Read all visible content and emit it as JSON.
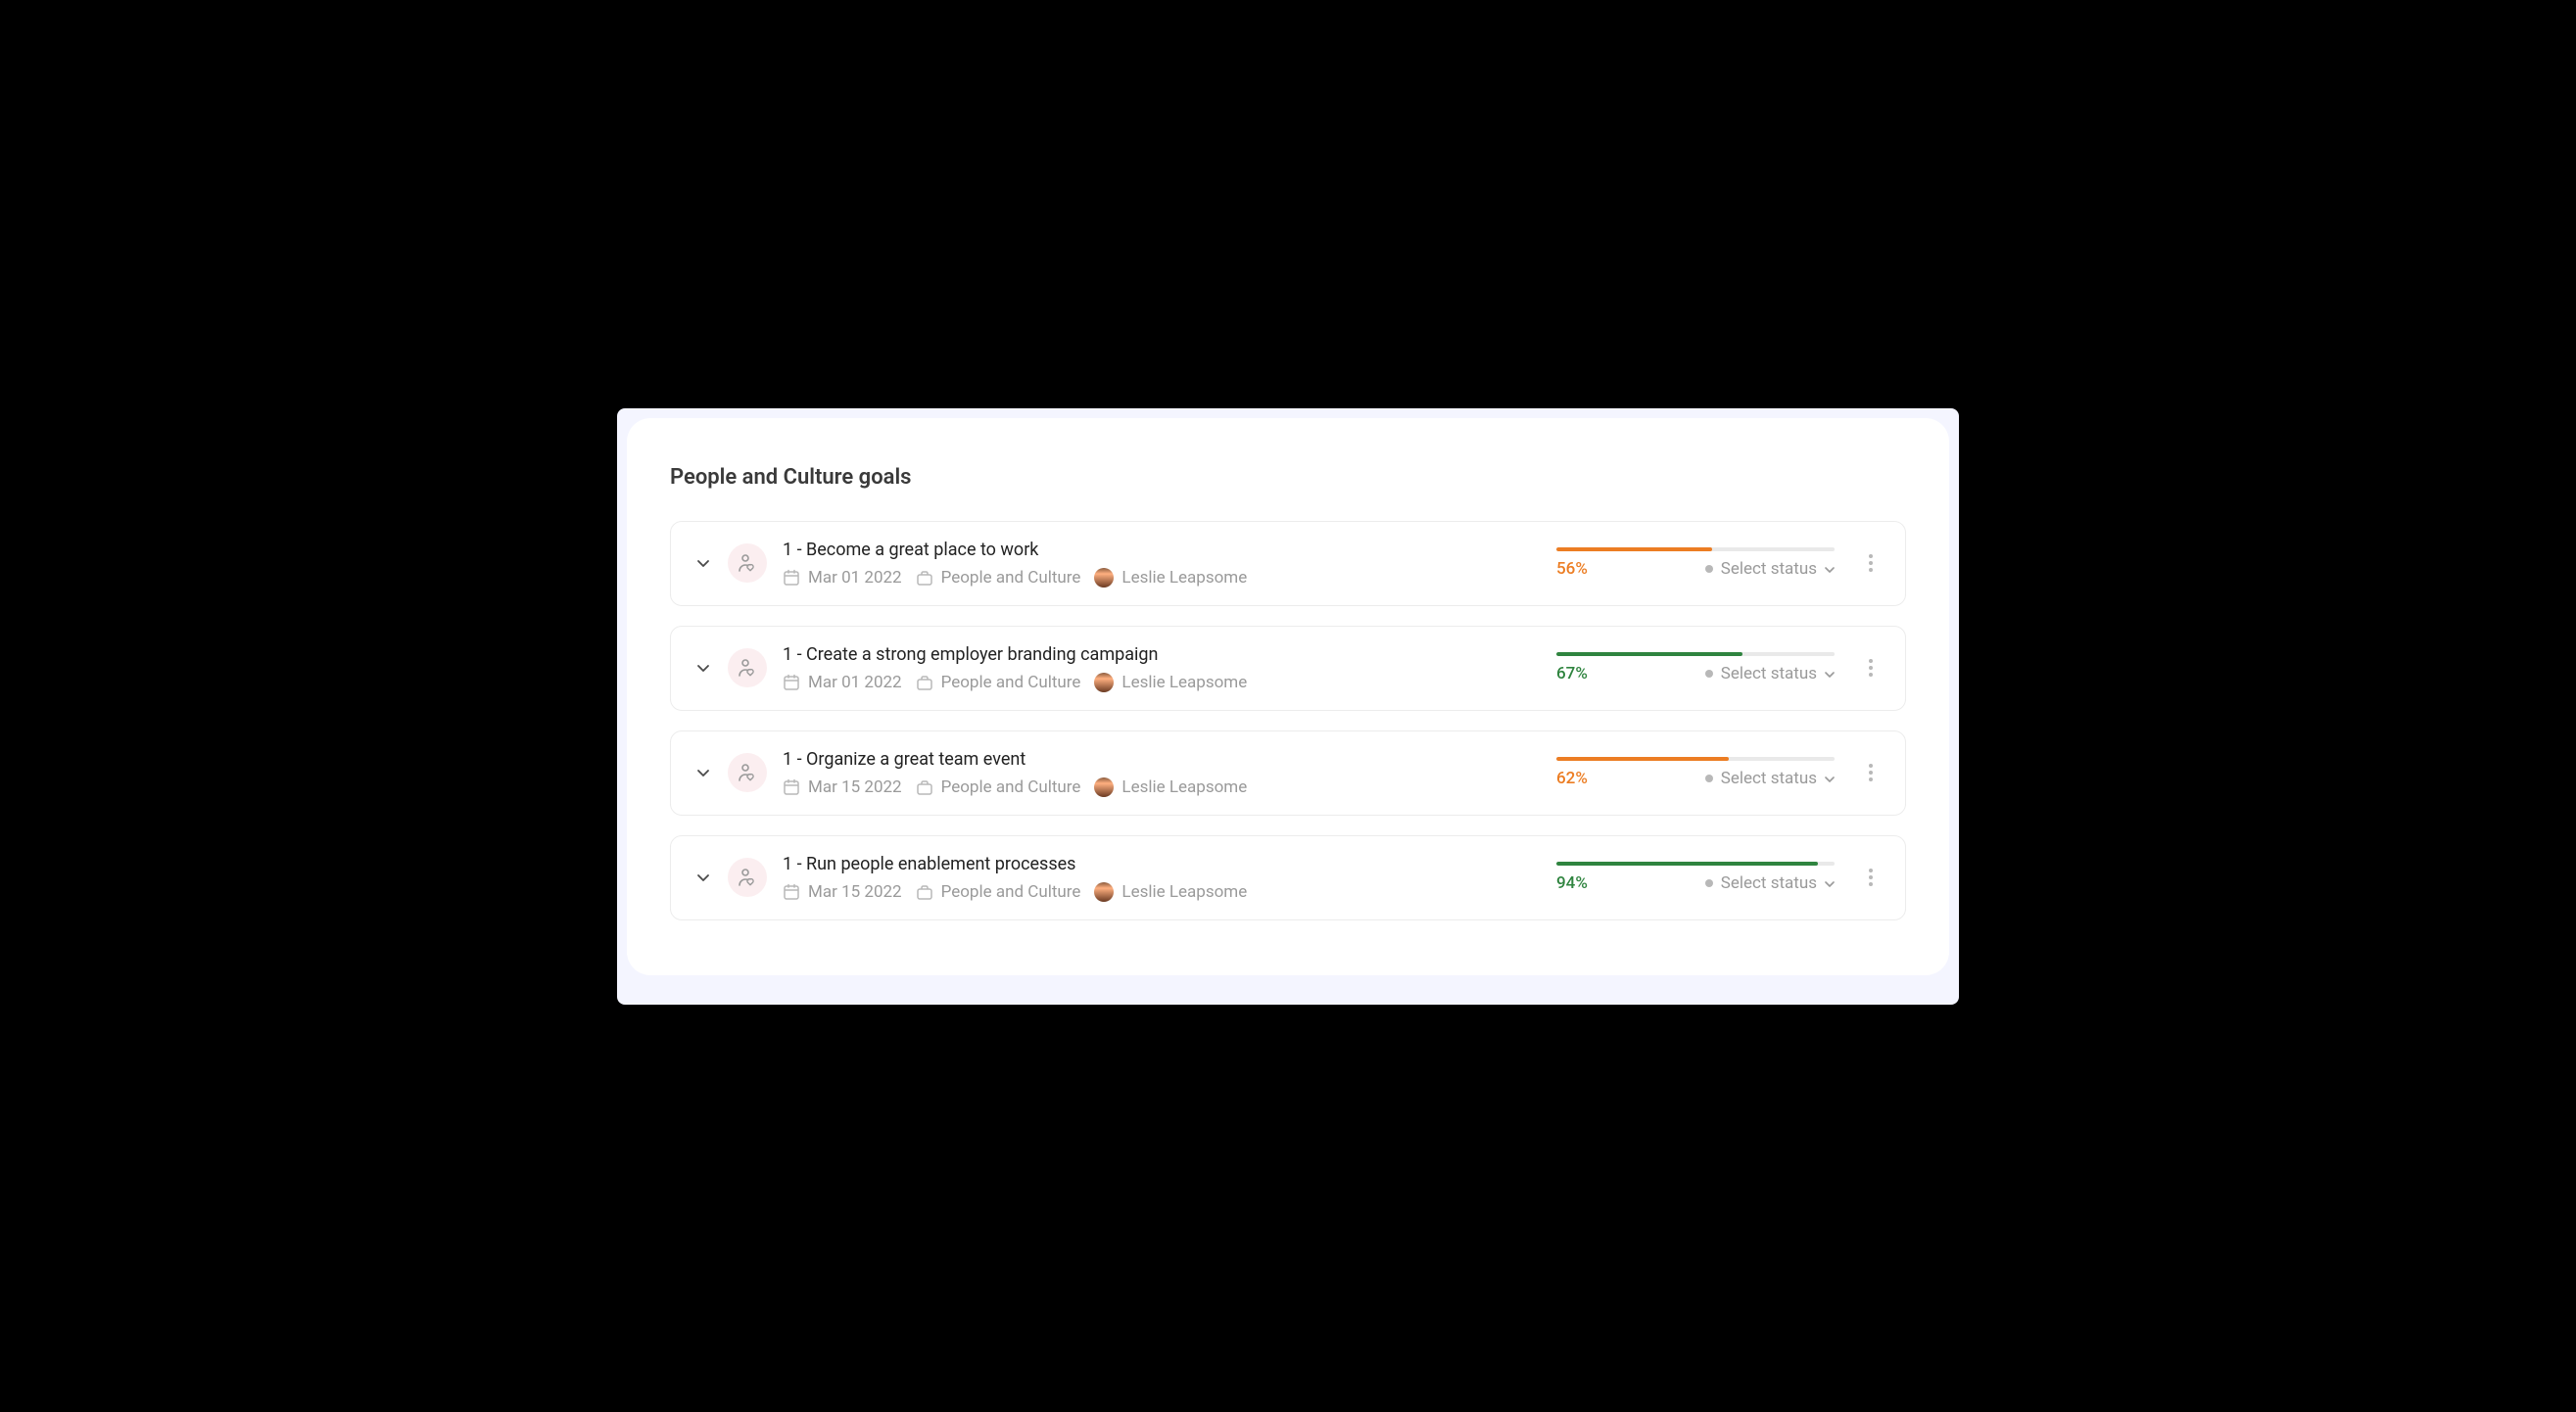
{
  "page_title": "People and Culture goals",
  "status_placeholder": "Select status",
  "goals": [
    {
      "title": "1 - Become a great place to work",
      "date": "Mar 01 2022",
      "team": "People and Culture",
      "owner": "Leslie Leapsome",
      "progress_pct": "56%",
      "progress_value": 56,
      "color": "orange"
    },
    {
      "title": "1 - Create a strong employer branding campaign",
      "date": "Mar 01 2022",
      "team": "People and Culture",
      "owner": "Leslie Leapsome",
      "progress_pct": "67%",
      "progress_value": 67,
      "color": "green"
    },
    {
      "title": "1 - Organize a great team event",
      "date": "Mar 15 2022",
      "team": "People and Culture",
      "owner": "Leslie Leapsome",
      "progress_pct": "62%",
      "progress_value": 62,
      "color": "orange"
    },
    {
      "title": "1 - Run people enablement processes",
      "date": "Mar 15 2022",
      "team": "People and Culture",
      "owner": "Leslie Leapsome",
      "progress_pct": "94%",
      "progress_value": 94,
      "color": "green"
    }
  ]
}
